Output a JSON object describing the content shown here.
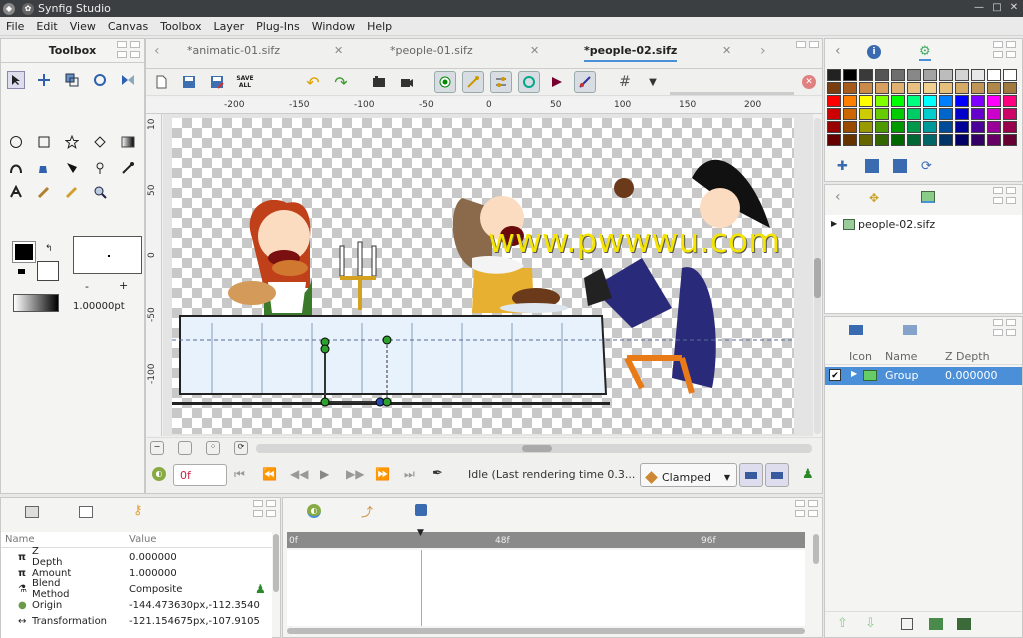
{
  "window": {
    "title": "Synfig Studio",
    "minimize": "—",
    "maximize": "□",
    "close": "✕"
  },
  "menu": [
    "File",
    "Edit",
    "View",
    "Canvas",
    "Toolbox",
    "Layer",
    "Plug-Ins",
    "Window",
    "Help"
  ],
  "toolbox": {
    "title": "Toolbox",
    "width_value": "1.00000pt",
    "minus": "-",
    "plus": "+"
  },
  "tabs": [
    {
      "label": "*animatic-01.sifz"
    },
    {
      "label": "*people-01.sifz"
    },
    {
      "label": "*people-02.sifz"
    }
  ],
  "ruler": {
    "h": [
      "-200",
      "-150",
      "-100",
      "-50",
      "0",
      "50",
      "100",
      "150",
      "200"
    ],
    "v": [
      "10",
      "50",
      "0",
      "-50",
      "-100"
    ]
  },
  "watermark": "www.pwwwu.com",
  "transport": {
    "frame": "0f",
    "status": "Idle (Last rendering time 0.3...",
    "interp": "Clamped"
  },
  "palette": {
    "colors": [
      "#222222",
      "#000000",
      "#3a3a3a",
      "#555555",
      "#6e6e6e",
      "#888888",
      "#a3a3a3",
      "#bcbcbc",
      "#d3d3d3",
      "#e8e8e8",
      "#ffffff",
      "#ffffff",
      "#7a3d10",
      "#a65a1c",
      "#c98a4a",
      "#d8a060",
      "#e0b070",
      "#e8c080",
      "#f0d090",
      "#e6c07a",
      "#d4aa66",
      "#c09658",
      "#b0884a",
      "#a07a3e",
      "#ff0000",
      "#ff7f00",
      "#ffff00",
      "#7fff00",
      "#00ff00",
      "#00ff7f",
      "#00ffff",
      "#007fff",
      "#0000ff",
      "#7f00ff",
      "#ff00ff",
      "#ff007f",
      "#cc0000",
      "#cc6600",
      "#cccc00",
      "#66cc00",
      "#00cc00",
      "#00cc66",
      "#00cccc",
      "#0066cc",
      "#0000cc",
      "#6600cc",
      "#cc00cc",
      "#cc0066",
      "#990000",
      "#994c00",
      "#999900",
      "#4c9900",
      "#009900",
      "#00994c",
      "#009999",
      "#004c99",
      "#000099",
      "#4c0099",
      "#990099",
      "#99004c",
      "#660000",
      "#663300",
      "#666600",
      "#336600",
      "#006600",
      "#006633",
      "#006666",
      "#003366",
      "#000066",
      "#330066",
      "#660066",
      "#660033"
    ]
  },
  "canvas_browser": {
    "file": "people-02.sifz"
  },
  "layers": {
    "headers": [
      "Icon",
      "Name",
      "Z Depth"
    ],
    "rows": [
      {
        "name": "Group",
        "z": "0.000000"
      }
    ]
  },
  "params": {
    "headers": [
      "Name",
      "Value"
    ],
    "rows": [
      {
        "icon": "π",
        "name": "Z Depth",
        "value": "0.000000"
      },
      {
        "icon": "π",
        "name": "Amount",
        "value": "1.000000"
      },
      {
        "icon": "⚗",
        "name": "Blend Method",
        "value": "Composite"
      },
      {
        "icon": "●",
        "name": "Origin",
        "value": "-144.473630px,-112.3540"
      },
      {
        "icon": "↔",
        "name": "Transformation",
        "value": "-121.154675px,-107.9105"
      }
    ]
  },
  "timetrack": {
    "marks": [
      "0f",
      "48f",
      "96f"
    ]
  }
}
